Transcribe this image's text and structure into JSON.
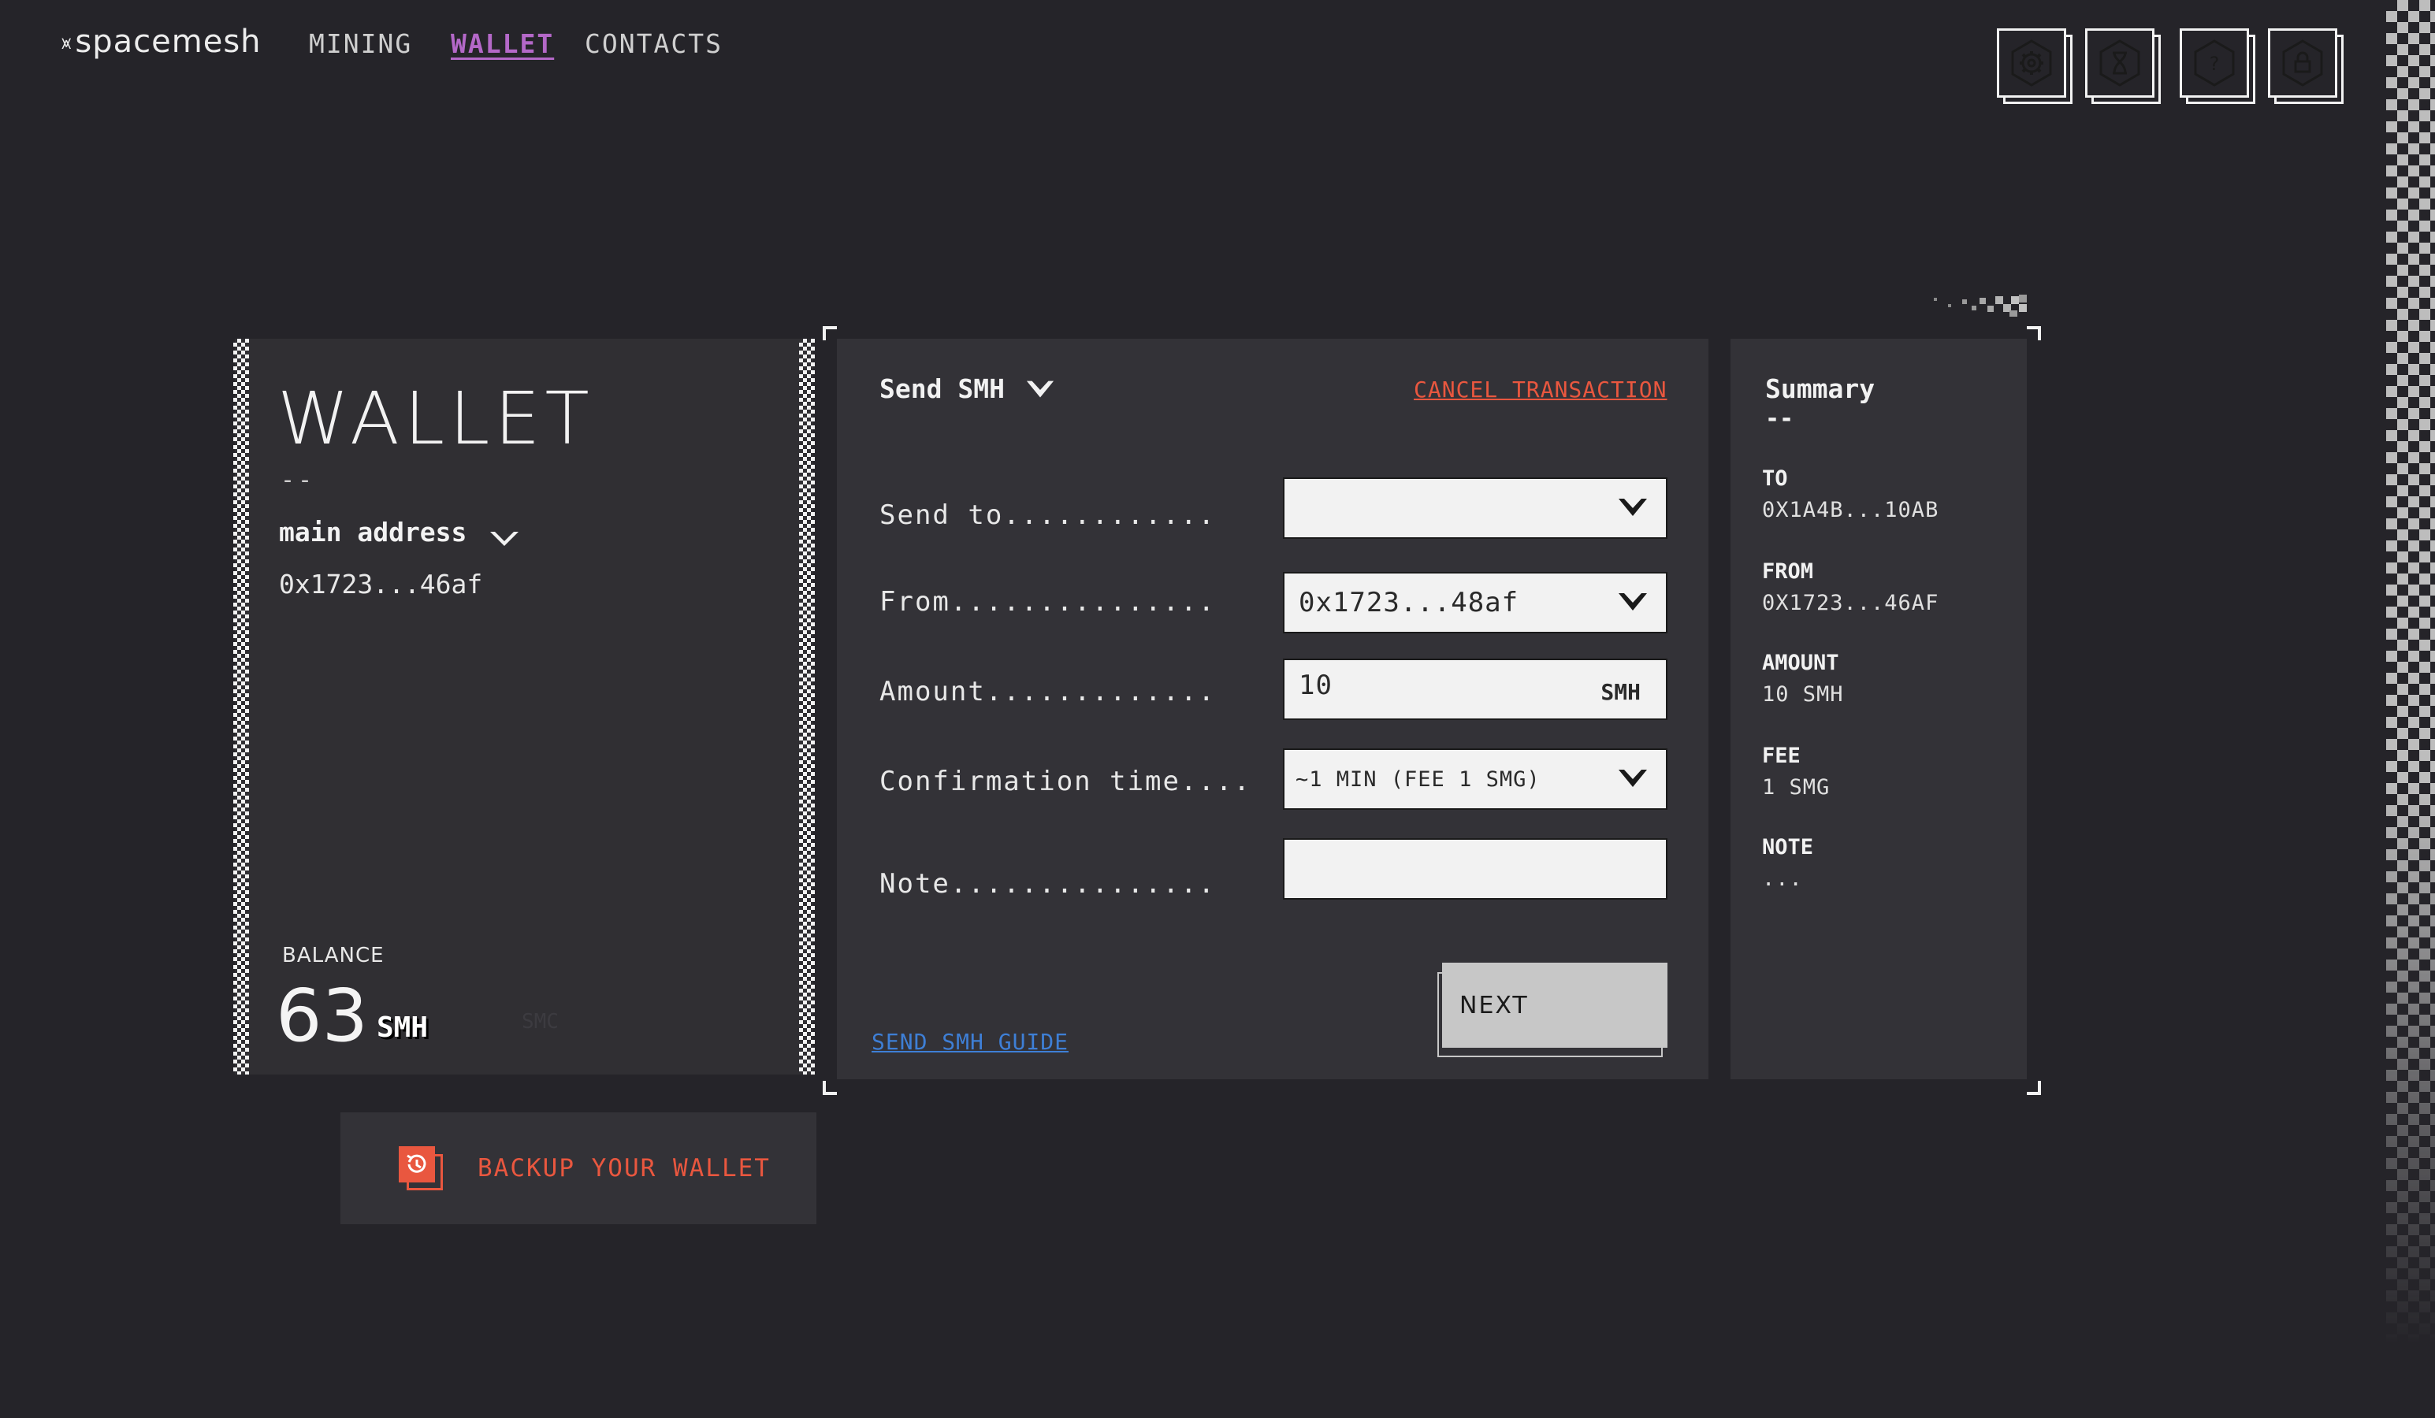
{
  "brand": {
    "logo_text": "spacemesh",
    "logo_mark": "⩙"
  },
  "nav": {
    "mining": "MINING",
    "wallet": "WALLET",
    "contacts": "CONTACTS"
  },
  "toolbar": {
    "icons": [
      "settings-icon",
      "hourglass-icon",
      "help-icon",
      "lock-icon"
    ]
  },
  "wallet": {
    "title": "WALLET",
    "dashes": "--",
    "address_label": "main address",
    "address_value": "0x1723...46af",
    "balance_label": "BALANCE",
    "balance_value": "63",
    "balance_unit": "SMH",
    "balance_unit_alt": "SMC",
    "backup_label": "BACKUP YOUR WALLET"
  },
  "send": {
    "title": "Send SMH",
    "cancel_label": "CANCEL TRANSACTION",
    "send_to_label": "Send to............",
    "send_to_value": "",
    "from_label": "From...............",
    "from_value": "0x1723...48af",
    "amount_label": "Amount.............",
    "amount_value": "10",
    "amount_unit": "SMH",
    "confirmation_label": "Confirmation time....",
    "confirmation_value": "~1 MIN (FEE 1 SMG)",
    "note_label": "Note...............",
    "note_value": "",
    "guide_label": "SEND SMH GUIDE",
    "next_label": "NEXT"
  },
  "summary": {
    "title": "Summary",
    "dash": "--",
    "to_key": "TO",
    "to_value": "0X1A4B...10AB",
    "from_key": "FROM",
    "from_value": "0X1723...46AF",
    "amount_key": "AMOUNT",
    "amount_value": "10 SMH",
    "fee_key": "FEE",
    "fee_value": "1 SMG",
    "note_key": "NOTE",
    "note_value": "..."
  },
  "colors": {
    "background": "#252429",
    "panel": "#333237",
    "accent_purple": "#b468c8",
    "accent_orange": "#e9573f",
    "link_blue": "#3e7fd6"
  }
}
